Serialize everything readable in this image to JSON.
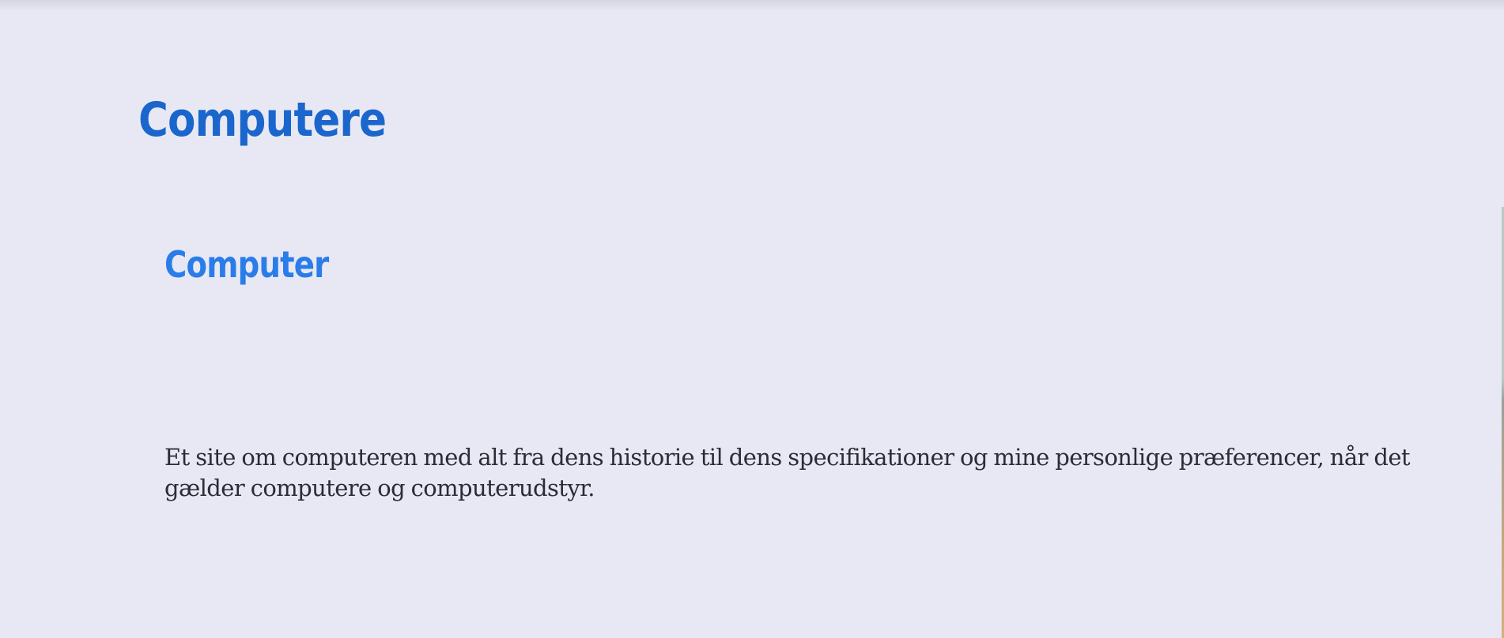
{
  "header": {
    "site_title": "Computere"
  },
  "main": {
    "section_title": "Computer",
    "intro": "Et site om computeren med alt fra dens historie til dens specifikationer og mine personlige præferencer, når det gælder computere og computerudstyr."
  },
  "colors": {
    "background": "#e8e8f4",
    "site_title": "#1a66cc",
    "section_title": "#2a7de8",
    "body_text": "#2c2c36"
  }
}
